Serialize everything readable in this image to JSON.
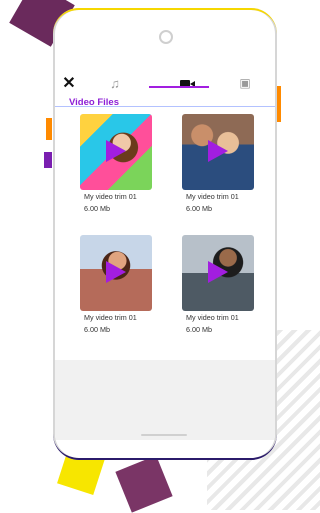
{
  "toolbar": {
    "close_icon": "close-icon",
    "tabs": [
      {
        "icon": "music-note-icon"
      },
      {
        "icon": "video-camera-icon",
        "active": true
      },
      {
        "icon": "image-icon"
      }
    ]
  },
  "section_title": "Video Files",
  "accent_color": "#a21ee0",
  "videos": [
    {
      "name": "My video  trim 01",
      "size": "6.00 Mb"
    },
    {
      "name": "My video  trim 01",
      "size": "6.00 Mb"
    },
    {
      "name": "My video  trim 01",
      "size": "6.00 Mb"
    },
    {
      "name": "My video  trim 01",
      "size": "6.00 Mb"
    }
  ]
}
